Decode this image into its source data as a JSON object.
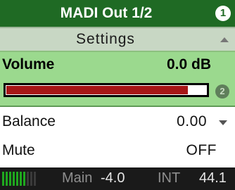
{
  "header": {
    "title": "MADI Out 1/2",
    "page_number": "1"
  },
  "subheader": {
    "label": "Settings"
  },
  "volume": {
    "label": "Volume",
    "value": "0.0 dB",
    "fill_fraction": 0.91,
    "bar_color": "#a61616",
    "step_number": "2"
  },
  "balance": {
    "label": "Balance",
    "value": "0.00"
  },
  "mute": {
    "label": "Mute",
    "value": "OFF"
  },
  "status_bar": {
    "meter_lit_segments": 7,
    "meter_total_segments": 10,
    "meter_color": "#1fa81f",
    "main_label": "Main",
    "main_level": "-4.0",
    "clock_label": "INT",
    "sample_rate": "44.1"
  },
  "colors": {
    "accent": "#1f6a24",
    "highlight_row": "#9bd98e"
  }
}
